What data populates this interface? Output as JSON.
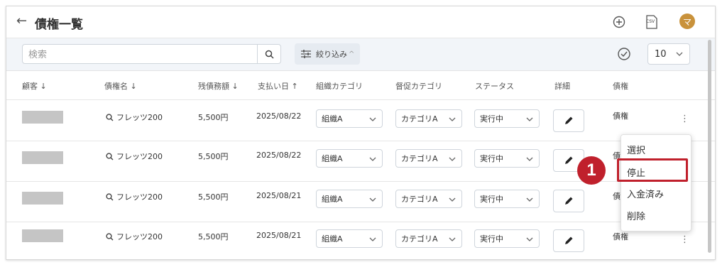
{
  "header": {
    "title": "債権一覧",
    "back_icon": "arrow-left-icon",
    "csv_label": "CSV",
    "avatar_initial": "マ"
  },
  "toolbar": {
    "search_placeholder": "検索",
    "filter_label": "絞り込み",
    "filter_caret": "^",
    "page_size": "10"
  },
  "columns": [
    "顧客",
    "債権名",
    "残債務額",
    "支払い日",
    "組織カテゴリ",
    "督促カテゴリ",
    "ステータス",
    "詳細",
    "債権"
  ],
  "sort_arrows": {
    "customer": "↓",
    "debt_name": "↓",
    "balance": "↓",
    "pay_date": "↑"
  },
  "rows": [
    {
      "debt_name": "フレッツ200",
      "balance": "5,500円",
      "pay_date": "2025/08/22",
      "org": "組織A",
      "dun": "カテゴリA",
      "status": "実行中",
      "claim": "債権"
    },
    {
      "debt_name": "フレッツ200",
      "balance": "5,500円",
      "pay_date": "2025/08/22",
      "org": "組織A",
      "dun": "カテゴリA",
      "status": "実行中",
      "claim": "債権"
    },
    {
      "debt_name": "フレッツ200",
      "balance": "5,500円",
      "pay_date": "2025/08/21",
      "org": "組織A",
      "dun": "カテゴリA",
      "status": "実行中",
      "claim": "債権"
    },
    {
      "debt_name": "フレッツ200",
      "balance": "5,500円",
      "pay_date": "2025/08/21",
      "org": "組織A",
      "dun": "カテゴリA",
      "status": "実行中",
      "claim": "債権"
    }
  ],
  "context_menu": {
    "items": [
      "選択",
      "停止",
      "入金済み",
      "削除"
    ]
  },
  "callout": {
    "number": "1"
  },
  "colors": {
    "highlight": "#c0202c",
    "avatar": "#c9923b",
    "toolbar_bg": "#f2f5f9"
  }
}
